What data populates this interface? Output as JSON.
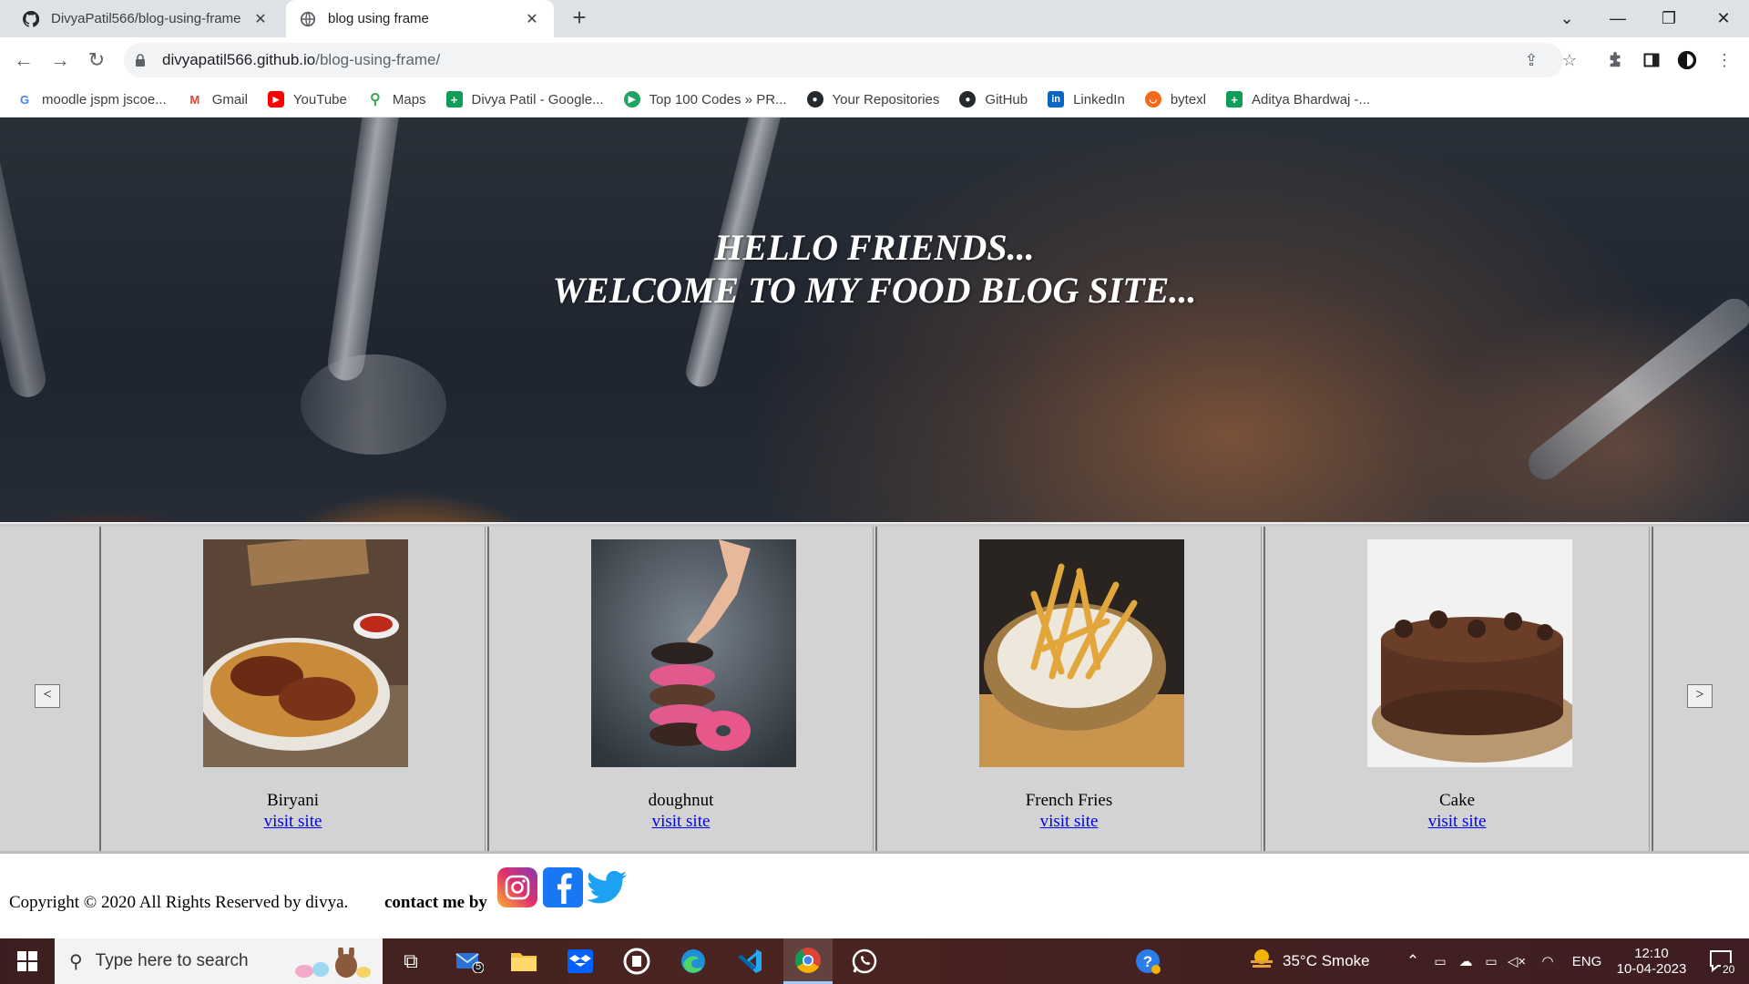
{
  "browser": {
    "tabs": [
      {
        "title": "DivyaPatil566/blog-using-frame",
        "icon": "github-icon",
        "active": false
      },
      {
        "title": "blog using frame",
        "icon": "globe-icon",
        "active": true
      }
    ],
    "new_tab": "+",
    "url_host": "divyapatil566.github.io",
    "url_path": "/blog-using-frame/",
    "bookmarks": [
      {
        "label": "moodle jspm jscoe...",
        "icon": "google-icon",
        "color": "#4285f4"
      },
      {
        "label": "Gmail",
        "icon": "gmail-icon",
        "color": "#ea4335"
      },
      {
        "label": "YouTube",
        "icon": "youtube-icon",
        "color": "#ff0000"
      },
      {
        "label": "Maps",
        "icon": "maps-icon",
        "color": "#34a853"
      },
      {
        "label": "Divya Patil - Google...",
        "icon": "sheets-icon",
        "color": "#0f9d58"
      },
      {
        "label": "Top 100 Codes » PR...",
        "icon": "codes-icon",
        "color": "#1fa463"
      },
      {
        "label": "Your Repositories",
        "icon": "github-icon",
        "color": "#24292e"
      },
      {
        "label": "GitHub",
        "icon": "github-icon",
        "color": "#24292e"
      },
      {
        "label": "LinkedIn",
        "icon": "linkedin-icon",
        "color": "#0a66c2"
      },
      {
        "label": "bytexl",
        "icon": "bytexl-icon",
        "color": "#f26b1d"
      },
      {
        "label": "Aditya Bhardwaj -...",
        "icon": "sheets-icon",
        "color": "#0f9d58"
      }
    ]
  },
  "page": {
    "hero_line1": "HELLO FRIENDS...",
    "hero_line2": "WELCOME TO MY FOOD BLOG SITE...",
    "prev_label": "<",
    "next_label": ">",
    "foods": [
      {
        "name": "Biryani",
        "link": "visit site"
      },
      {
        "name": "doughnut",
        "link": "visit site"
      },
      {
        "name": "French Fries",
        "link": "visit site"
      },
      {
        "name": "Cake",
        "link": "visit site"
      }
    ],
    "footer": {
      "copyright": "Copyright © 2020 All Rights Reserved by divya.",
      "contact": "contact me by"
    }
  },
  "taskbar": {
    "search_placeholder": "Type here to search",
    "mail_badge": "5",
    "weather": "35°C  Smoke",
    "language": "ENG",
    "time": "12:10",
    "date": "10-04-2023",
    "notifications": "20"
  }
}
